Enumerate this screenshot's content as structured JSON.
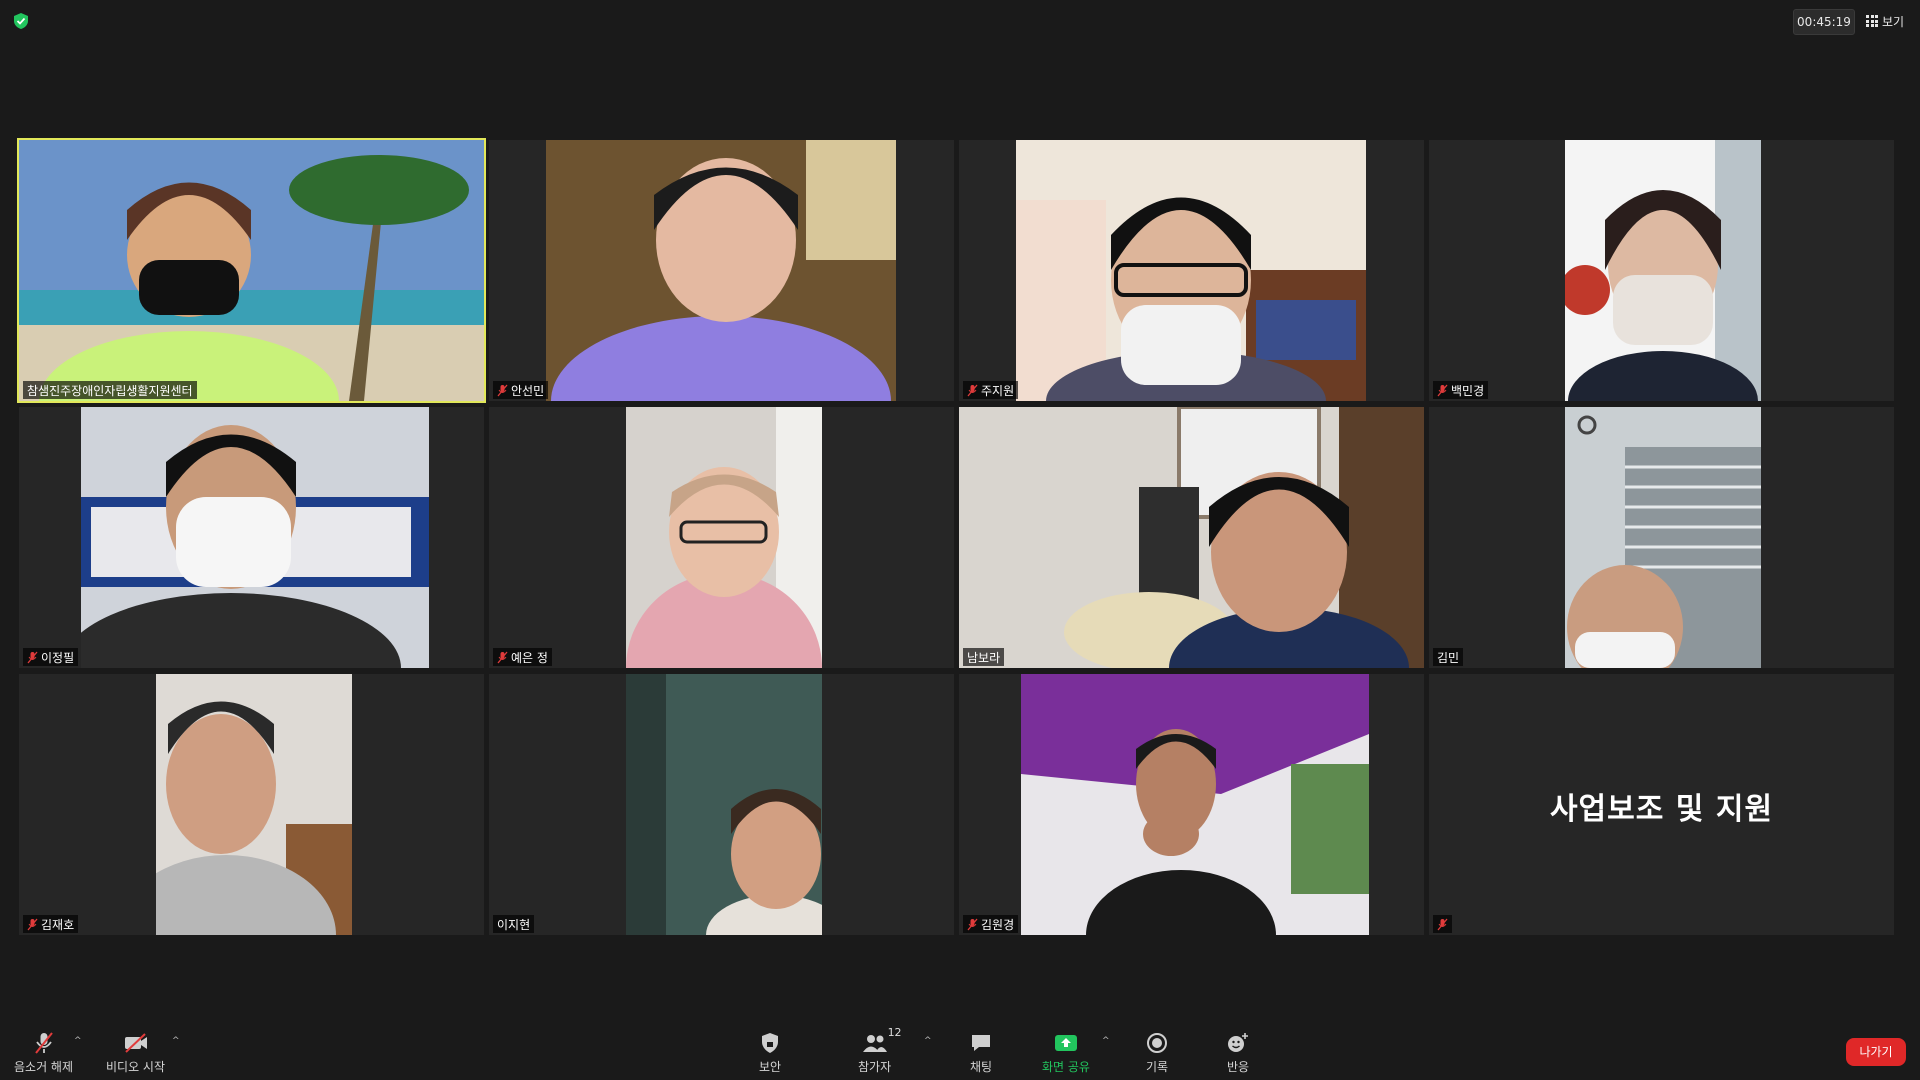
{
  "header": {
    "timer": "00:45:19",
    "view_label": "보기"
  },
  "participants": [
    {
      "name": "참샘진주장애인자립생활지원센터",
      "muted": false,
      "active": true
    },
    {
      "name": "안선민",
      "muted": true
    },
    {
      "name": "주지원",
      "muted": true
    },
    {
      "name": "백민경",
      "muted": true
    },
    {
      "name": "이정필",
      "muted": true
    },
    {
      "name": "예은 정",
      "muted": true
    },
    {
      "name": "남보라",
      "muted": false
    },
    {
      "name": "김민",
      "muted": false
    },
    {
      "name": "김재호",
      "muted": true
    },
    {
      "name": "이지현",
      "muted": false
    },
    {
      "name": "김원경",
      "muted": true
    },
    {
      "name": "",
      "muted": true,
      "video_off_text": "사업보조 및 지원"
    }
  ],
  "toolbar": {
    "unmute_label": "음소거 해제",
    "video_label": "비디오 시작",
    "security_label": "보안",
    "participants_label": "참가자",
    "participants_count": "12",
    "chat_label": "채팅",
    "share_label": "화면 공유",
    "record_label": "기록",
    "reactions_label": "반응",
    "leave_label": "나가기"
  },
  "colors": {
    "background": "#1a1a1a",
    "tile": "#262626",
    "active_speaker_border": "#e2e85a",
    "share_green": "#22c55e",
    "leave_red": "#e02828",
    "mute_red": "#e03b3b"
  }
}
